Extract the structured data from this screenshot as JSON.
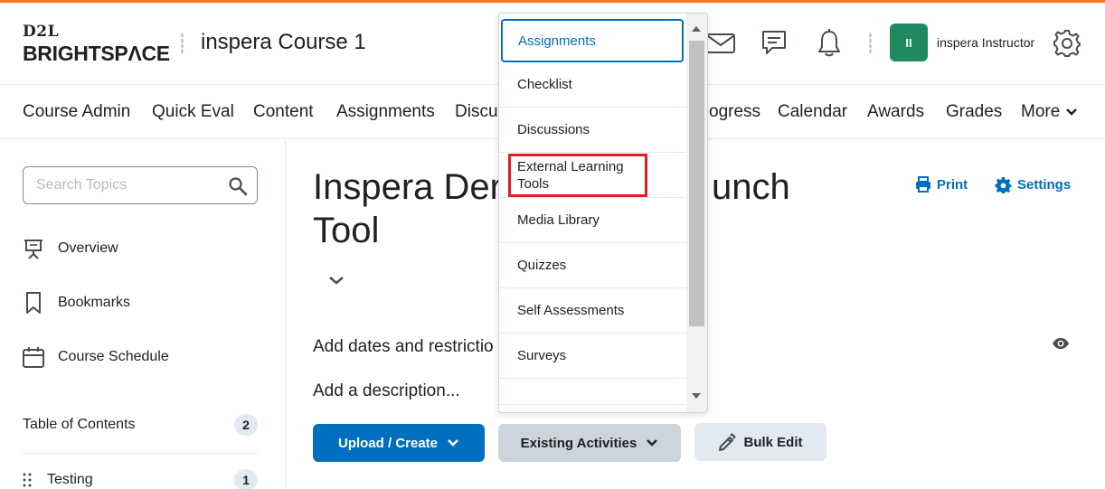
{
  "colors": {
    "accent": "#f47920",
    "primary": "#006fbf",
    "link": "#006fbf",
    "avatar": "#1f8a5f",
    "highlight": "#e01e26"
  },
  "header": {
    "logo_top": "D2L",
    "logo_bottom": "BRIGHTSPΛCE",
    "course_title": "inspera Course 1",
    "icons": [
      "email-icon",
      "messages-icon",
      "notification-bell-icon",
      "settings-gear-icon"
    ],
    "avatar_initials": "II",
    "user_name": "inspera Instructor"
  },
  "nav": {
    "items": [
      "Course Admin",
      "Quick Eval",
      "Content",
      "Assignments",
      "Discu",
      "ogress",
      "Calendar",
      "Awards",
      "Grades",
      "More"
    ]
  },
  "sidebar": {
    "search_placeholder": "Search Topics",
    "items": [
      {
        "label": "Overview",
        "icon": "presentation-icon"
      },
      {
        "label": "Bookmarks",
        "icon": "bookmark-icon"
      },
      {
        "label": "Course Schedule",
        "icon": "calendar-icon"
      }
    ],
    "toc": [
      {
        "label": "Table of Contents",
        "count": "2"
      },
      {
        "label": "Testing",
        "count": "1"
      }
    ]
  },
  "main": {
    "title_line1": "Inspera Der",
    "title_line1b": "unch",
    "title_line2": "Tool",
    "print_label": "Print",
    "settings_label": "Settings",
    "dates_text": "Add dates and restrictio",
    "description_text": "Add a description...",
    "upload_label": "Upload / Create",
    "existing_label": "Existing Activities",
    "bulk_label": "Bulk Edit"
  },
  "dropdown": {
    "items": [
      "Assignments",
      "Checklist",
      "Discussions",
      "External Learning Tools",
      "Media Library",
      "Quizzes",
      "Self Assessments",
      "Surveys"
    ],
    "selected_index": 0,
    "highlighted_index": 3
  }
}
